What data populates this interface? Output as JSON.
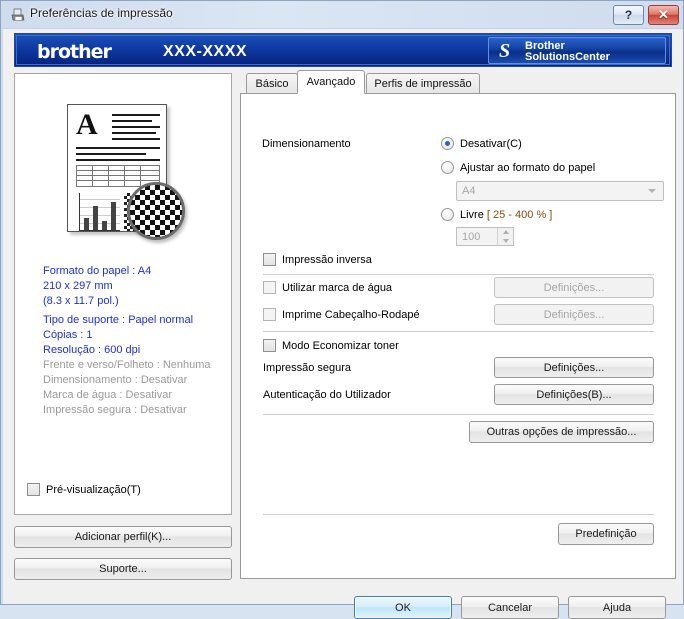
{
  "window": {
    "title": "Preferências de impressão",
    "icon": "printer-icon",
    "help_glyph": "?",
    "close_glyph": "✕"
  },
  "banner": {
    "brand": "brother",
    "model": "XXX-XXXX",
    "solutions_center": {
      "monogram": "S",
      "line1": "Brother",
      "line2": "SolutionsCenter"
    }
  },
  "preview": {
    "summary": [
      {
        "text": "Formato do papel : A4",
        "state": "active"
      },
      {
        "text": "210 x 297 mm",
        "state": "active"
      },
      {
        "text": "(8.3 x 11.7 pol.)",
        "state": "active"
      },
      {
        "text": "Tipo de suporte : Papel normal",
        "state": "active"
      },
      {
        "text": "Cópias : 1",
        "state": "active"
      },
      {
        "text": "Resolução : 600 dpi",
        "state": "active"
      },
      {
        "text": "Frente e verso/Folheto : Nenhuma",
        "state": "inactive"
      },
      {
        "text": "Dimensionamento : Desativar",
        "state": "inactive"
      },
      {
        "text": "Marca de água : Desativar",
        "state": "inactive"
      },
      {
        "text": "Impressão segura : Desativar",
        "state": "inactive"
      }
    ],
    "preview_checkbox": {
      "label": "Pré-visualização(T)",
      "checked": false
    }
  },
  "tabs": [
    {
      "label": "Básico",
      "active": false
    },
    {
      "label": "Avançado",
      "active": true
    },
    {
      "label": "Perfis de impressão",
      "active": false
    }
  ],
  "advanced": {
    "scaling": {
      "label": "Dimensionamento",
      "options": [
        {
          "label": "Desativar(C)",
          "selected": true
        },
        {
          "label": "Ajustar ao formato do papel",
          "selected": false
        },
        {
          "label": "Livre [ 25 - 400 % ]",
          "selected": false,
          "label_main": "Livre",
          "label_range": "[ 25 - 400 % ]"
        }
      ],
      "paper_size_value": "A4",
      "free_value": "100"
    },
    "reverse_print": {
      "label": "Impressão inversa",
      "checked": false
    },
    "watermark": {
      "label": "Utilizar marca de água",
      "checked": false,
      "button": "Definições...",
      "enabled": false
    },
    "header_footer": {
      "label": "Imprime Cabeçalho-Rodapé",
      "checked": false,
      "button": "Definições...",
      "enabled": false
    },
    "toner_save": {
      "label": "Modo Economizar toner",
      "checked": false
    },
    "secure_print": {
      "label": "Impressão segura",
      "button": "Definições...",
      "enabled": true
    },
    "user_auth": {
      "label": "Autenticação do Utilizador",
      "button": "Definições(B)...",
      "enabled": true
    },
    "other_options_button": "Outras opções de impressão...",
    "default_button": "Predefinição"
  },
  "footer": {
    "add_profile": "Adicionar perfil(K)...",
    "support": "Suporte...",
    "ok": "OK",
    "cancel": "Cancelar",
    "help": "Ajuda"
  },
  "colors": {
    "banner_blue": "#0e37a0",
    "summary_active": "#1e2edc",
    "summary_inactive": "#9a9a9a",
    "range_text": "#8a4a12",
    "default_button_border": "#3c7fb1"
  }
}
